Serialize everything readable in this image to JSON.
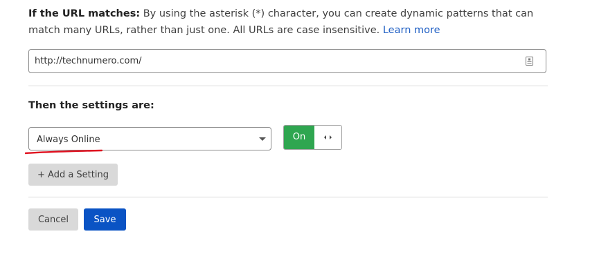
{
  "url_rule": {
    "label": "If the URL matches:",
    "description": " By using the asterisk (*) character, you can create dynamic patterns that can match many URLs, rather than just one. All URLs are case insensitive. ",
    "learn_more": "Learn more",
    "value": "http://technumero.com/",
    "icon": "document-icon"
  },
  "settings": {
    "title": "Then the settings are:",
    "selected": "Always Online",
    "toggle": {
      "label": "On",
      "state": "on",
      "color": "#2fa650"
    },
    "add_label": "+ Add a Setting"
  },
  "actions": {
    "cancel": "Cancel",
    "save": "Save",
    "save_color": "#0a53c4"
  },
  "annotation": {
    "underline_color": "#e0101f"
  }
}
